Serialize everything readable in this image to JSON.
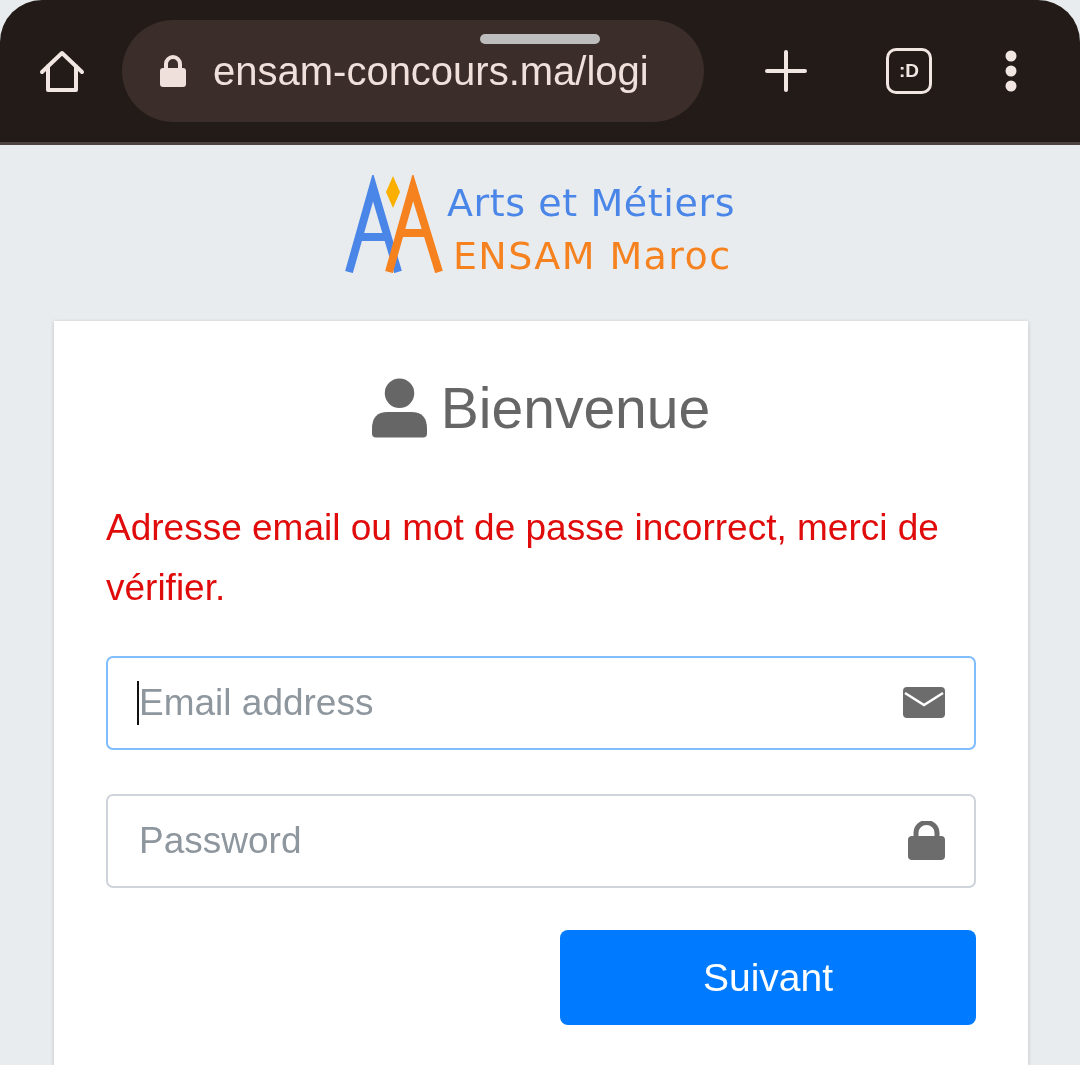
{
  "browser": {
    "url": "ensam-concours.ma/logi",
    "tab_switcher": ":D"
  },
  "logo": {
    "line_1": "Arts et Métiers",
    "line_2": "ENSAM Maroc"
  },
  "login_card": {
    "title": "Bienvenue",
    "error": "Adresse email ou mot de passe incorrect, merci de vérifier.",
    "fields": [
      {
        "kind": "email",
        "placeholder": "Email address",
        "focused": true
      },
      {
        "kind": "password",
        "placeholder": "Password",
        "focused": false
      }
    ],
    "submit": "Suivant"
  }
}
